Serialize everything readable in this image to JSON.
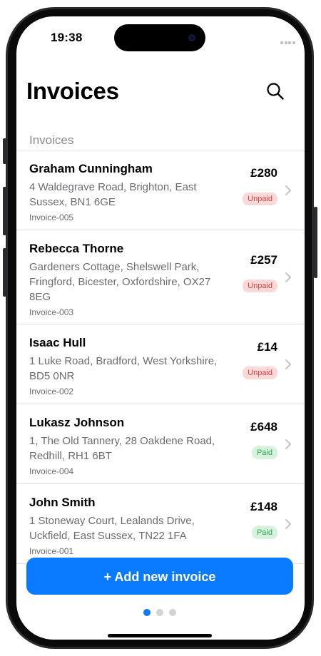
{
  "status_bar": {
    "time": "19:38"
  },
  "header": {
    "title": "Invoices",
    "search_icon": "search-icon"
  },
  "section": {
    "title": "Invoices"
  },
  "invoices": [
    {
      "name": "Graham Cunningham",
      "address": "4 Waldegrave Road, Brighton, East Sussex, BN1 6GE",
      "id": "Invoice-005",
      "amount": "£280",
      "status": "Unpaid"
    },
    {
      "name": "Rebecca Thorne",
      "address": "Gardeners Cottage, Shelswell Park, Fringford, Bicester, Oxfordshire, OX27 8EG",
      "id": "Invoice-003",
      "amount": "£257",
      "status": "Unpaid"
    },
    {
      "name": "Isaac Hull",
      "address": "1 Luke Road, Bradford, West Yorkshire, BD5 0NR",
      "id": "Invoice-002",
      "amount": "£14",
      "status": "Unpaid"
    },
    {
      "name": "Lukasz Johnson",
      "address": "1, The Old Tannery, 28 Oakdene Road, Redhill, RH1 6BT",
      "id": "Invoice-004",
      "amount": "£648",
      "status": "Paid"
    },
    {
      "name": "John Smith",
      "address": "1 Stoneway Court, Lealands Drive, Uckfield, East Sussex, TN22 1FA",
      "id": "Invoice-001",
      "amount": "£148",
      "status": "Paid"
    }
  ],
  "actions": {
    "add_label": "+ Add new invoice"
  },
  "pagination": {
    "active_index": 0,
    "total": 3
  },
  "colors": {
    "accent": "#0a7bff",
    "unpaid_text": "#d64541",
    "unpaid_bg": "#fbd9d8",
    "paid_text": "#34a853",
    "paid_bg": "#d5f3dc"
  }
}
